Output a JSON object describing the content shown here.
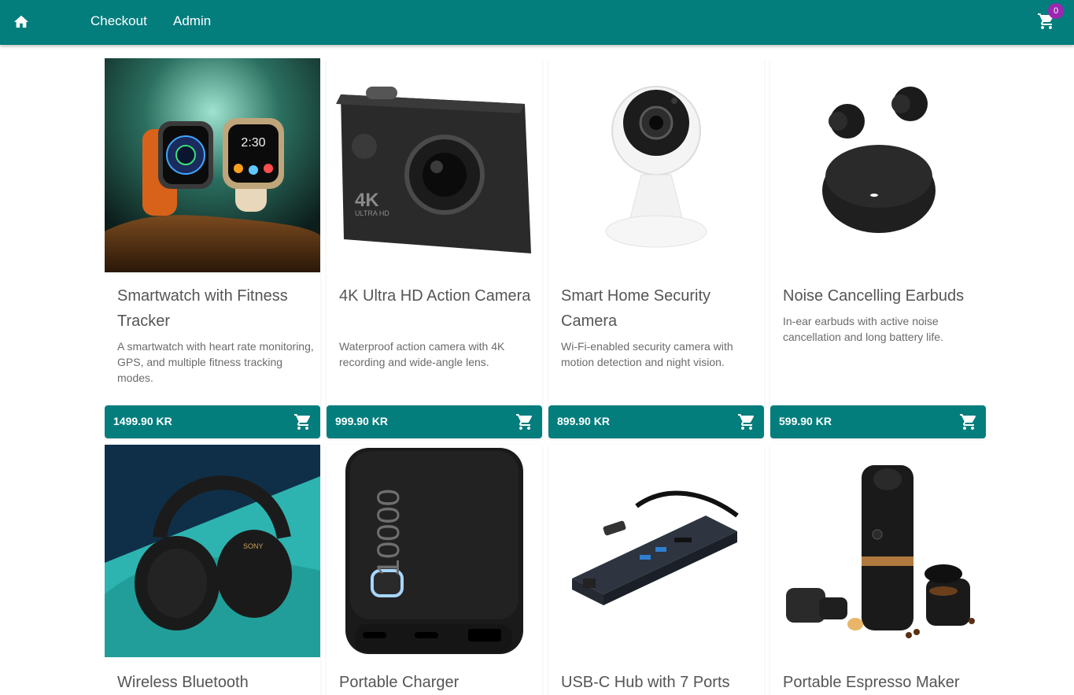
{
  "nav": {
    "home_icon": "home-icon",
    "checkout_label": "Checkout",
    "admin_label": "Admin",
    "cart_icon": "cart-icon",
    "cart_count": "0"
  },
  "colors": {
    "primary": "#047d7d",
    "badge": "#9c27b0"
  },
  "products": [
    {
      "title": "Smartwatch with Fitness Tracker",
      "description": "A smartwatch with heart rate monitoring, GPS, and multiple fitness tracking modes.",
      "price": "1499.90 KR"
    },
    {
      "title": "4K Ultra HD Action Camera",
      "description": "Waterproof action camera with 4K recording and wide-angle lens.",
      "price": "999.90 KR"
    },
    {
      "title": "Smart Home Security Camera",
      "description": "Wi-Fi-enabled security camera with motion detection and night vision.",
      "price": "899.90 KR"
    },
    {
      "title": "Noise Cancelling Earbuds",
      "description": "In-ear earbuds with active noise cancellation and long battery life.",
      "price": "599.90 KR"
    },
    {
      "title": "Wireless Bluetooth"
    },
    {
      "title": "Portable Charger"
    },
    {
      "title": "USB-C Hub with 7 Ports"
    },
    {
      "title": "Portable Espresso Maker"
    }
  ],
  "image_text": {
    "camera_brand": "4K",
    "camera_sub": "ULTRA HD",
    "charger_text": "10000",
    "headphones_brand": "SONY",
    "watch_time": "2:30"
  }
}
